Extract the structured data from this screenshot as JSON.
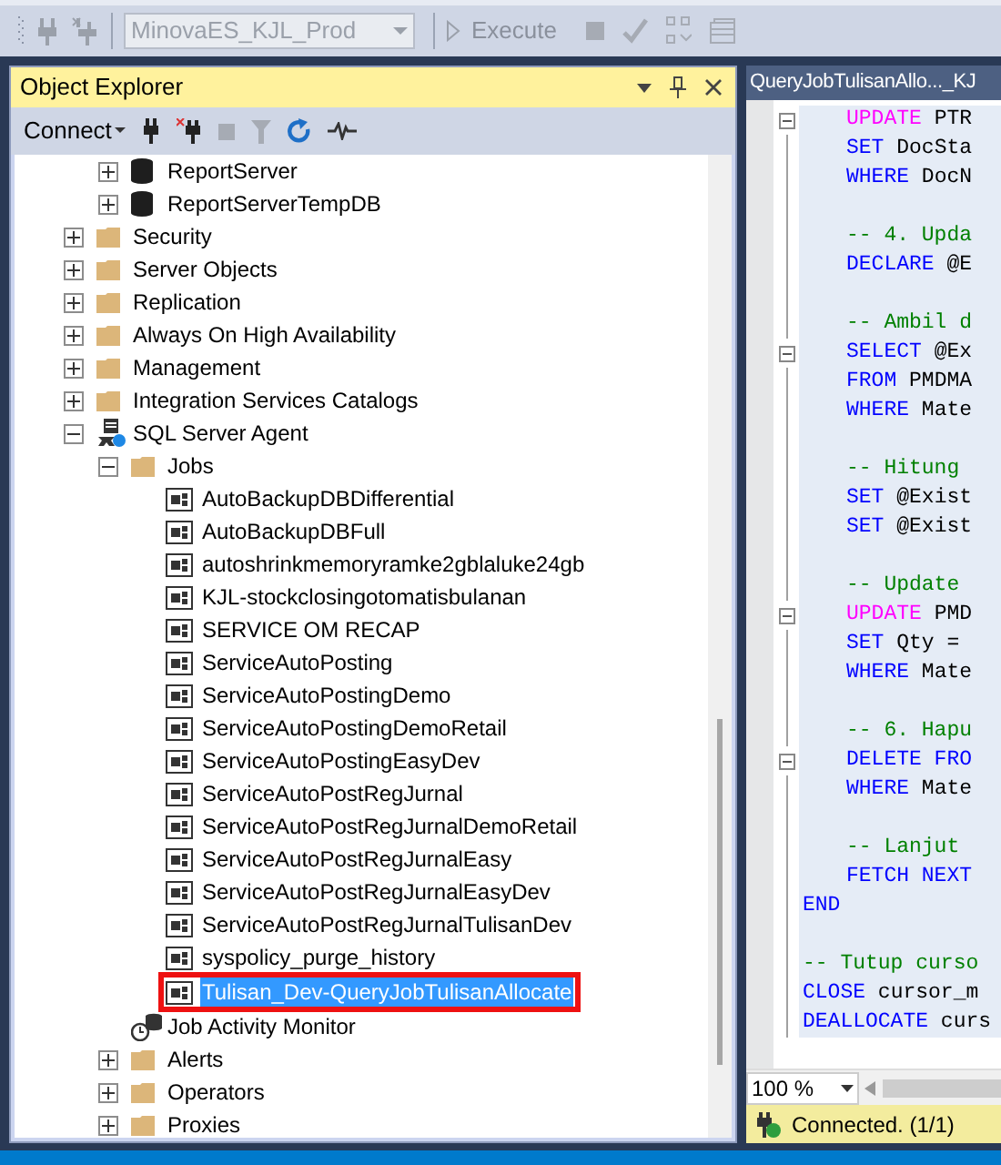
{
  "toolbar": {
    "database": {
      "value": "MinovaES_KJL_Prod",
      "disabled": true
    },
    "execute": {
      "label": "Execute",
      "disabled": true
    }
  },
  "object_explorer": {
    "title": "Object Explorer",
    "connect": "Connect",
    "tree": [
      {
        "label": "ReportServer",
        "kind": "database",
        "expanded": false
      },
      {
        "label": "ReportServerTempDB",
        "kind": "database",
        "expanded": false
      },
      {
        "label": "Security",
        "kind": "folder",
        "expanded": false
      },
      {
        "label": "Server Objects",
        "kind": "folder",
        "expanded": false
      },
      {
        "label": "Replication",
        "kind": "folder",
        "expanded": false
      },
      {
        "label": "Always On High Availability",
        "kind": "folder",
        "expanded": false
      },
      {
        "label": "Management",
        "kind": "folder",
        "expanded": false
      },
      {
        "label": "Integration Services Catalogs",
        "kind": "folder",
        "expanded": false
      },
      {
        "label": "SQL Server Agent",
        "kind": "agent",
        "expanded": true,
        "children": [
          {
            "label": "Jobs",
            "kind": "folder",
            "expanded": true,
            "children": [
              {
                "label": "AutoBackupDBDifferential",
                "kind": "job",
                "selected": false
              },
              {
                "label": "AutoBackupDBFull",
                "kind": "job",
                "selected": false
              },
              {
                "label": "autoshrinkmemoryramke2gblaluke24gb",
                "kind": "job",
                "selected": false
              },
              {
                "label": "KJL-stockclosingotomatisbulanan",
                "kind": "job",
                "selected": false
              },
              {
                "label": "SERVICE OM RECAP",
                "kind": "job",
                "selected": false
              },
              {
                "label": "ServiceAutoPosting",
                "kind": "job",
                "selected": false
              },
              {
                "label": "ServiceAutoPostingDemo",
                "kind": "job",
                "selected": false
              },
              {
                "label": "ServiceAutoPostingDemoRetail",
                "kind": "job",
                "selected": false
              },
              {
                "label": "ServiceAutoPostingEasyDev",
                "kind": "job",
                "selected": false
              },
              {
                "label": "ServiceAutoPostRegJurnal",
                "kind": "job",
                "selected": false
              },
              {
                "label": "ServiceAutoPostRegJurnalDemoRetail",
                "kind": "job",
                "selected": false
              },
              {
                "label": "ServiceAutoPostRegJurnalEasy",
                "kind": "job",
                "selected": false
              },
              {
                "label": "ServiceAutoPostRegJurnalEasyDev",
                "kind": "job",
                "selected": false
              },
              {
                "label": "ServiceAutoPostRegJurnalTulisanDev",
                "kind": "job",
                "selected": false
              },
              {
                "label": "syspolicy_purge_history",
                "kind": "job",
                "selected": false
              },
              {
                "label": "Tulisan_Dev-QueryJobTulisanAllocate",
                "kind": "job",
                "selected": true,
                "marked": true
              }
            ]
          },
          {
            "label": "Job Activity Monitor",
            "kind": "monitor"
          },
          {
            "label": "Alerts",
            "kind": "folder",
            "expanded": false
          },
          {
            "label": "Operators",
            "kind": "folder",
            "expanded": false
          },
          {
            "label": "Proxies",
            "kind": "folder",
            "expanded": false
          }
        ]
      }
    ]
  },
  "editor": {
    "tab": "QueryJobTulisanAllo..._KJ",
    "lines": [
      {
        "kind": "inner",
        "fold": true,
        "tokens": [
          {
            "kind": "system",
            "text": "UPDATE"
          },
          {
            "kind": "plain",
            "text": " PTR"
          }
        ]
      },
      {
        "kind": "inner",
        "tokens": [
          {
            "kind": "keyword",
            "text": "SET"
          },
          {
            "kind": "plain",
            "text": " DocSta"
          }
        ]
      },
      {
        "kind": "inner",
        "tokens": [
          {
            "kind": "keyword",
            "text": "WHERE"
          },
          {
            "kind": "plain",
            "text": " DocN"
          }
        ]
      },
      {
        "kind": "blank"
      },
      {
        "kind": "inner",
        "tokens": [
          {
            "kind": "comment",
            "text": "-- 4. Upda"
          }
        ]
      },
      {
        "kind": "inner",
        "tokens": [
          {
            "kind": "keyword",
            "text": "DECLARE"
          },
          {
            "kind": "plain",
            "text": " @E"
          }
        ]
      },
      {
        "kind": "blank"
      },
      {
        "kind": "inner",
        "tokens": [
          {
            "kind": "comment",
            "text": "-- Ambil d"
          }
        ]
      },
      {
        "kind": "inner",
        "fold": true,
        "tokens": [
          {
            "kind": "keyword",
            "text": "SELECT"
          },
          {
            "kind": "plain",
            "text": " @Ex"
          }
        ]
      },
      {
        "kind": "inner",
        "tokens": [
          {
            "kind": "keyword",
            "text": "FROM"
          },
          {
            "kind": "plain",
            "text": " PMDMA"
          }
        ]
      },
      {
        "kind": "inner",
        "tokens": [
          {
            "kind": "keyword",
            "text": "WHERE"
          },
          {
            "kind": "plain",
            "text": " Mate"
          }
        ]
      },
      {
        "kind": "blank"
      },
      {
        "kind": "inner",
        "tokens": [
          {
            "kind": "comment",
            "text": "-- Hitung"
          }
        ]
      },
      {
        "kind": "inner",
        "tokens": [
          {
            "kind": "keyword",
            "text": "SET"
          },
          {
            "kind": "plain",
            "text": " @Exist"
          }
        ]
      },
      {
        "kind": "inner",
        "tokens": [
          {
            "kind": "keyword",
            "text": "SET"
          },
          {
            "kind": "plain",
            "text": " @Exist"
          }
        ]
      },
      {
        "kind": "blank"
      },
      {
        "kind": "inner",
        "tokens": [
          {
            "kind": "comment",
            "text": "-- Update"
          }
        ]
      },
      {
        "kind": "inner",
        "fold": true,
        "tokens": [
          {
            "kind": "system",
            "text": "UPDATE"
          },
          {
            "kind": "plain",
            "text": " PMD"
          }
        ]
      },
      {
        "kind": "inner",
        "tokens": [
          {
            "kind": "keyword",
            "text": "SET"
          },
          {
            "kind": "plain",
            "text": " Qty ="
          }
        ]
      },
      {
        "kind": "inner",
        "tokens": [
          {
            "kind": "keyword",
            "text": "WHERE"
          },
          {
            "kind": "plain",
            "text": " Mate"
          }
        ]
      },
      {
        "kind": "blank"
      },
      {
        "kind": "inner",
        "tokens": [
          {
            "kind": "comment",
            "text": "-- 6. Hapu"
          }
        ]
      },
      {
        "kind": "inner",
        "fold": true,
        "tokens": [
          {
            "kind": "keyword",
            "text": "DELETE FRO"
          }
        ]
      },
      {
        "kind": "inner",
        "tokens": [
          {
            "kind": "keyword",
            "text": "WHERE"
          },
          {
            "kind": "plain",
            "text": " Mate"
          }
        ]
      },
      {
        "kind": "blank"
      },
      {
        "kind": "inner",
        "tokens": [
          {
            "kind": "comment",
            "text": "-- Lanjut"
          }
        ]
      },
      {
        "kind": "inner",
        "tokens": [
          {
            "kind": "keyword",
            "text": "FETCH NEXT"
          }
        ]
      },
      {
        "kind": "outer",
        "tokens": [
          {
            "kind": "keyword",
            "text": "END"
          }
        ]
      },
      {
        "kind": "blank"
      },
      {
        "kind": "outer",
        "tokens": [
          {
            "kind": "comment",
            "text": "-- Tutup curso"
          }
        ]
      },
      {
        "kind": "outer",
        "tokens": [
          {
            "kind": "keyword",
            "text": "CLOSE"
          },
          {
            "kind": "plain",
            "text": " cursor_m"
          }
        ]
      },
      {
        "kind": "outer",
        "tokens": [
          {
            "kind": "keyword",
            "text": "DEALLOCATE"
          },
          {
            "kind": "plain",
            "text": " curs"
          }
        ]
      }
    ],
    "zoom": "100 %",
    "status": "Connected. (1/1)"
  }
}
